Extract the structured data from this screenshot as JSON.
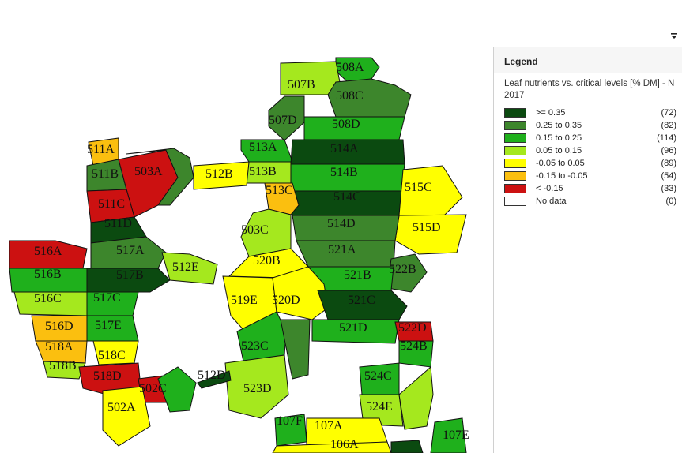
{
  "legend": {
    "header": "Legend",
    "title": "Leaf nutrients vs. critical levels [% DM] - N 2017",
    "items": [
      {
        "label": ">= 0.35",
        "count": "(72)",
        "color": "#0b4a10"
      },
      {
        "label": "0.25 to 0.35",
        "count": "(82)",
        "color": "#3d862c"
      },
      {
        "label": "0.15 to 0.25",
        "count": "(114)",
        "color": "#1fb01c"
      },
      {
        "label": "0.05 to 0.15",
        "count": "(96)",
        "color": "#a5e81e"
      },
      {
        "label": "-0.05 to 0.05",
        "count": "(89)",
        "color": "#ffff00"
      },
      {
        "label": "-0.15 to -0.05",
        "count": "(54)",
        "color": "#fbbf0f"
      },
      {
        "label": "< -0.15",
        "count": "(33)",
        "color": "#cc1111"
      },
      {
        "label": "No data",
        "count": "(0)",
        "color": "#ffffff"
      }
    ]
  },
  "plot_labels": [
    "508A",
    "507B",
    "508C",
    "507D",
    "508D",
    "513A",
    "514A",
    "511A",
    "511B",
    "503A",
    "512B",
    "513B",
    "514B",
    "515C",
    "513C",
    "514C",
    "511C",
    "511D",
    "515D",
    "503C",
    "514D",
    "516A",
    "517A",
    "521A",
    "520B",
    "512E",
    "522B",
    "516B",
    "517B",
    "521B",
    "519E",
    "520D",
    "521C",
    "516C",
    "517C",
    "516D",
    "517E",
    "521D",
    "522D",
    "518A",
    "518C",
    "523C",
    "524B",
    "518B",
    "518D",
    "512D",
    "524C",
    "502C",
    "523D",
    "502A",
    "524E",
    "107F",
    "107A",
    "106A",
    "107E"
  ]
}
